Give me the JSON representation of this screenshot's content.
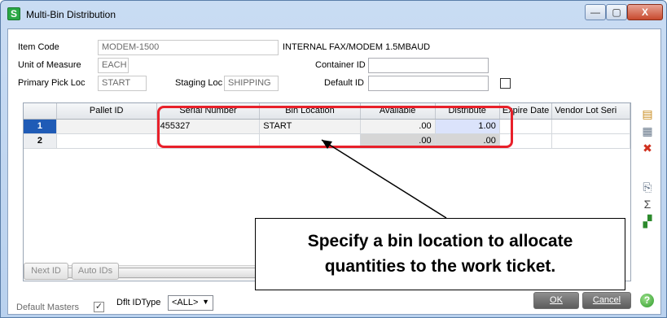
{
  "window": {
    "title": "Multi-Bin Distribution",
    "app_icon_letter": "S",
    "controls": {
      "minimize": "—",
      "maximize": "▢",
      "close": "X"
    }
  },
  "header": {
    "item_code_label": "Item Code",
    "item_code_value": "MODEM-1500",
    "item_description": "INTERNAL FAX/MODEM 1.5MBAUD",
    "uom_label": "Unit of Measure",
    "uom_value": "EACH",
    "container_id_label": "Container ID",
    "container_id_value": "",
    "primary_pick_label": "Primary Pick Loc",
    "primary_pick_value": "START",
    "staging_loc_label": "Staging Loc",
    "staging_loc_value": "SHIPPING",
    "default_id_label": "Default ID",
    "default_id_value": ""
  },
  "grid": {
    "columns": [
      "",
      "Pallet ID",
      "Serial Number",
      "Bin Location",
      "Available",
      "Distribute",
      "Expire Date",
      "Vendor Lot Seri"
    ],
    "rows": [
      {
        "num": "1",
        "pallet_id": "",
        "serial_number": "455327",
        "bin_location": "START",
        "available": ".00",
        "distribute": "1.00",
        "expire_date": "",
        "vendor_lot": ""
      },
      {
        "num": "2",
        "pallet_id": "",
        "serial_number": "",
        "bin_location": "",
        "available": ".00",
        "distribute": ".00",
        "expire_date": "",
        "vendor_lot": ""
      }
    ]
  },
  "side_icons": [
    "grid-layout-icon",
    "grid-columns-icon",
    "delete-row-icon",
    "lookup-icon",
    "sum-icon",
    "distribute-icon"
  ],
  "callout": {
    "line1": "Specify a bin location to allocate",
    "line2": "quantities to the work ticket."
  },
  "footer": {
    "next_id": "Next ID",
    "auto_ids": "Auto IDs",
    "default_masters_label": "Default Masters",
    "dflt_id_type_label": "Dflt IDType",
    "dflt_id_type_value": "<ALL>",
    "ok": "OK",
    "cancel": "Cancel",
    "help": "?"
  },
  "colors": {
    "highlight": "#e8202a",
    "selected_row": "#1f5bb6",
    "distribute_cell": "#dbe3fb"
  }
}
